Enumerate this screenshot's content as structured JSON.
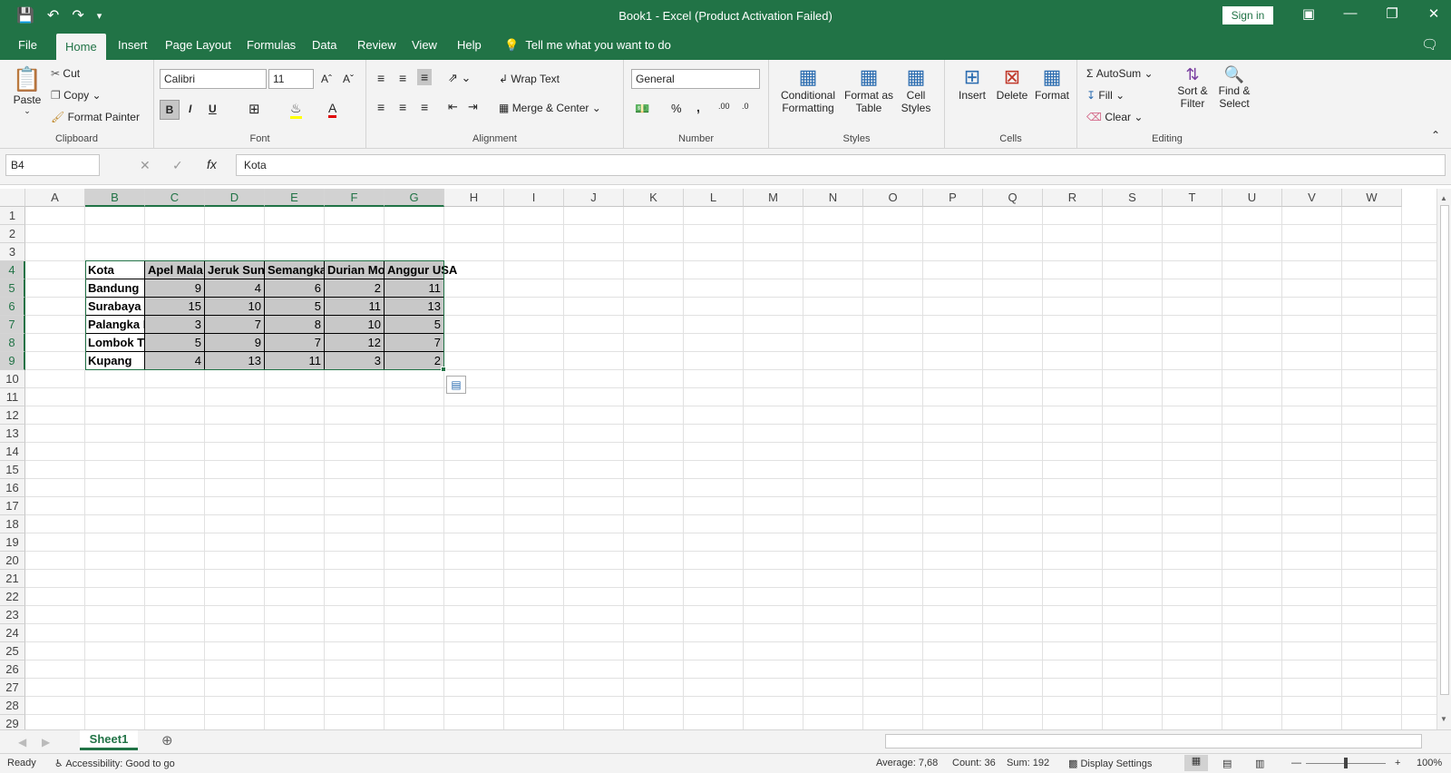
{
  "window": {
    "title": "Book1  -  Excel (Product Activation Failed)",
    "signin": "Sign in"
  },
  "tabs": [
    "File",
    "Home",
    "Insert",
    "Page Layout",
    "Formulas",
    "Data",
    "Review",
    "View",
    "Help"
  ],
  "tell_me": "Tell me what you want to do",
  "ribbon": {
    "clipboard": {
      "label": "Clipboard",
      "paste": "Paste",
      "cut": "Cut",
      "copy": "Copy",
      "format_painter": "Format Painter"
    },
    "font": {
      "label": "Font",
      "name": "Calibri",
      "size": "11"
    },
    "alignment": {
      "label": "Alignment",
      "wrap": "Wrap Text",
      "merge": "Merge & Center"
    },
    "number": {
      "label": "Number",
      "format": "General"
    },
    "styles": {
      "label": "Styles",
      "conditional": "Conditional",
      "conditional2": "Formatting",
      "format_table": "Format as",
      "format_table2": "Table",
      "cell_styles": "Cell",
      "cell_styles2": "Styles"
    },
    "cells": {
      "label": "Cells",
      "insert": "Insert",
      "delete": "Delete",
      "format": "Format"
    },
    "editing": {
      "label": "Editing",
      "autosum": "AutoSum",
      "fill": "Fill",
      "clear": "Clear",
      "sort": "Sort &",
      "sort2": "Filter",
      "find": "Find &",
      "find2": "Select"
    }
  },
  "formula_bar": {
    "name_box": "B4",
    "content": "Kota",
    "fx": "fx"
  },
  "columns": [
    "A",
    "B",
    "C",
    "D",
    "E",
    "F",
    "G",
    "H",
    "I",
    "J",
    "K",
    "L",
    "M",
    "N",
    "O",
    "P",
    "Q",
    "R",
    "S",
    "T",
    "U",
    "V",
    "W"
  ],
  "rows": [
    "1",
    "2",
    "3",
    "4",
    "5",
    "6",
    "7",
    "8",
    "9",
    "10",
    "11",
    "12",
    "13",
    "14",
    "15",
    "16",
    "17",
    "18",
    "19",
    "20",
    "21",
    "22",
    "23",
    "24",
    "25",
    "26",
    "27",
    "28",
    "29"
  ],
  "table": {
    "header": [
      "Kota",
      "Apel Mala",
      "Jeruk Sunl",
      "Semangka",
      "Durian Mo",
      "Anggur USA"
    ],
    "rows": [
      {
        "city": "Bandung",
        "values": [
          "9",
          "4",
          "6",
          "2",
          "11"
        ]
      },
      {
        "city": "Surabaya",
        "values": [
          "15",
          "10",
          "5",
          "11",
          "13"
        ]
      },
      {
        "city": "Palangka R",
        "values": [
          "3",
          "7",
          "8",
          "10",
          "5"
        ]
      },
      {
        "city": "Lombok T",
        "values": [
          "5",
          "9",
          "7",
          "12",
          "7"
        ]
      },
      {
        "city": "Kupang",
        "values": [
          "4",
          "13",
          "11",
          "3",
          "2"
        ]
      }
    ]
  },
  "sheet": {
    "tab": "Sheet1"
  },
  "status": {
    "ready": "Ready",
    "accessibility": "Accessibility: Good to go",
    "average": "Average: 7,68",
    "count": "Count: 36",
    "sum": "Sum: 192",
    "display": "Display Settings",
    "zoom": "100%"
  }
}
